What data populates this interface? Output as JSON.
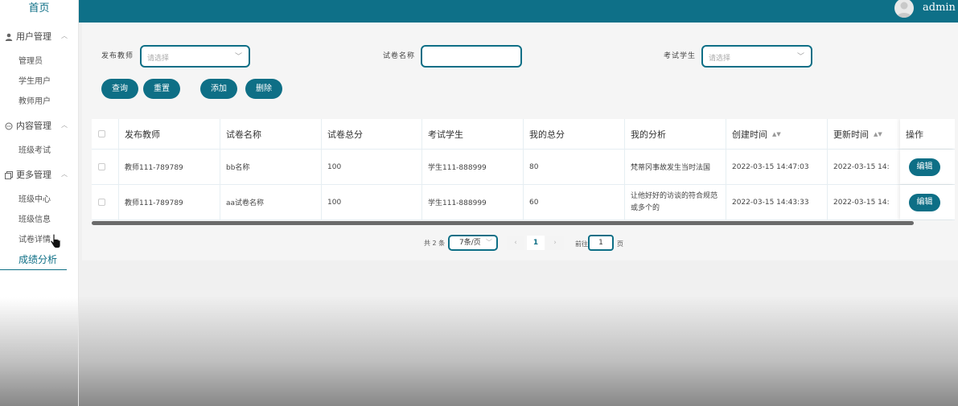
{
  "sidebar": {
    "home": "首页",
    "groups": [
      {
        "label": "用户管理",
        "icon": "user-icon",
        "items": [
          "管理员",
          "学生用户",
          "教师用户"
        ]
      },
      {
        "label": "内容管理",
        "icon": "chat-icon",
        "items": [
          "班级考试"
        ]
      },
      {
        "label": "更多管理",
        "icon": "copy-icon",
        "items": [
          "班级中心",
          "班级信息",
          "试卷详情",
          "成绩分析"
        ]
      }
    ],
    "active_item": "成绩分析"
  },
  "header": {
    "user": "admin"
  },
  "filters": {
    "teacher_label": "发布教师",
    "teacher_placeholder": "请选择",
    "paper_label": "试卷名称",
    "paper_value": "",
    "student_label": "考试学生",
    "student_placeholder": "请选择"
  },
  "actions": {
    "query": "查询",
    "reset": "重置",
    "add": "添加",
    "delete": "删除"
  },
  "table": {
    "columns": [
      "发布教师",
      "试卷名称",
      "试卷总分",
      "考试学生",
      "我的总分",
      "我的分析",
      "创建时间",
      "更新时间",
      "操作"
    ],
    "rows": [
      {
        "teacher": "教师111-789789",
        "paper": "bb名称",
        "total": "100",
        "student": "学生111-888999",
        "score": "80",
        "analysis": "梵蒂冈事故发生当时法国",
        "created": "2022-03-15 14:47:03",
        "updated": "2022-03-15 14:",
        "edit": "编辑"
      },
      {
        "teacher": "教师111-789789",
        "paper": "aa试卷名称",
        "total": "100",
        "student": "学生111-888999",
        "score": "60",
        "analysis": "让他好好的访谈的符合规范或多个的",
        "created": "2022-03-15 14:43:33",
        "updated": "2022-03-15 14:",
        "edit": "编辑"
      }
    ]
  },
  "pagination": {
    "total_text": "共 2 条",
    "page_size": "7条/页",
    "current_page": "1",
    "goto_label": "前往",
    "goto_value": "1",
    "page_suffix": "页",
    "prev": "‹",
    "next": "›"
  },
  "colors": {
    "accent": "#0e6f86"
  }
}
